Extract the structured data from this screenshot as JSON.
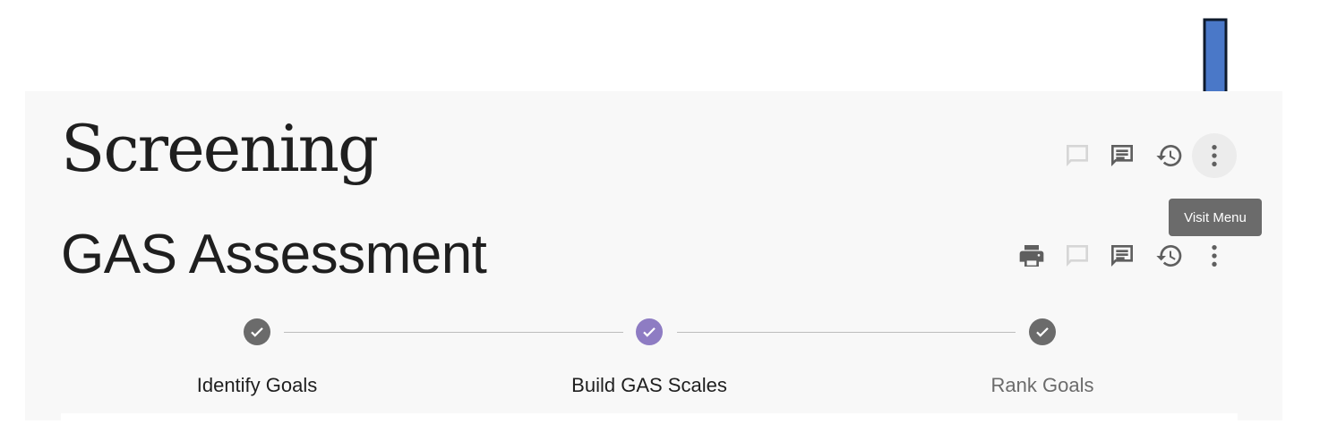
{
  "header": {
    "page_title": "Screening",
    "section_title": "GAS Assessment"
  },
  "toolbar_top": {
    "icons": [
      "comment-outline-icon",
      "comment-filled-icon",
      "history-icon",
      "more-vert-icon"
    ]
  },
  "toolbar_section": {
    "icons": [
      "print-icon",
      "comment-outline-icon",
      "comment-filled-icon",
      "history-icon",
      "more-vert-icon"
    ]
  },
  "tooltip": {
    "text": "Visit Menu"
  },
  "stepper": {
    "steps": [
      {
        "label": "Identify Goals",
        "state": "complete",
        "color": "#6b6b6b"
      },
      {
        "label": "Build GAS Scales",
        "state": "active",
        "color": "#8e7cc3"
      },
      {
        "label": "Rank Goals",
        "state": "complete",
        "color": "#6b6b6b"
      }
    ]
  },
  "colors": {
    "panel_bg": "#f8f8f8",
    "icon_gray": "#5f5f5f",
    "icon_light": "#d6d6d6",
    "accent_purple": "#8e7cc3",
    "arrow_fill": "#4a78c8"
  }
}
